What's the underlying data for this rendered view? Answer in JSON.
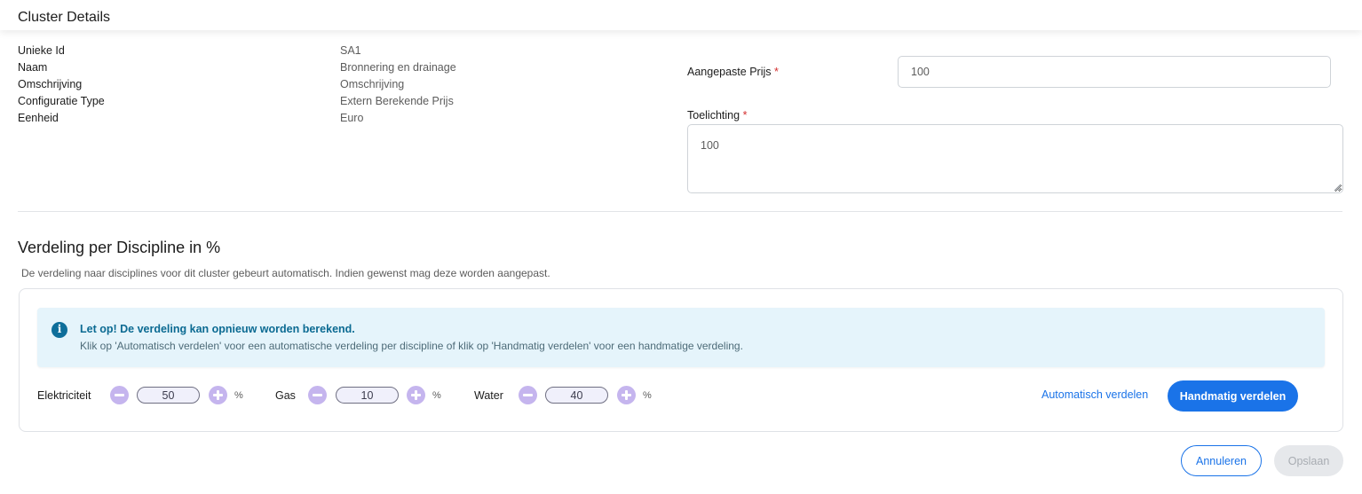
{
  "header": {
    "title": "Cluster Details"
  },
  "details": [
    {
      "label": "Unieke Id",
      "value": "SA1"
    },
    {
      "label": "Naam",
      "value": "Bronnering en drainage"
    },
    {
      "label": "Omschrijving",
      "value": "Omschrijving"
    },
    {
      "label": "Configuratie Type",
      "value": "Extern Berekende Prijs"
    },
    {
      "label": "Eenheid",
      "value": "Euro"
    }
  ],
  "form": {
    "price_label": "Aangepaste Prijs",
    "price_value": "100",
    "notes_label": "Toelichting",
    "notes_value": "100",
    "required_mark": "*"
  },
  "distribution": {
    "title": "Verdeling per Discipline in %",
    "description": "De verdeling naar disciplines voor dit cluster gebeurt automatisch. Indien gewenst mag deze worden aangepast.",
    "alert": {
      "icon": "info-icon",
      "title": "Let op! De verdeling kan opnieuw worden berekend.",
      "text": "Klik op 'Automatisch verdelen' voor een automatische verdeling per discipline of klik op 'Handmatig verdelen' voor een handmatige verdeling."
    },
    "disciplines": [
      {
        "label": "Elektriciteit",
        "value": "50",
        "unit": "%"
      },
      {
        "label": "Gas",
        "value": "10",
        "unit": "%"
      },
      {
        "label": "Water",
        "value": "40",
        "unit": "%"
      }
    ],
    "auto_label": "Automatisch verdelen",
    "manual_label": "Handmatig verdelen"
  },
  "footer": {
    "cancel_label": "Annuleren",
    "save_label": "Opslaan"
  },
  "colors": {
    "primary": "#1a73e8",
    "alert_bg": "#e5f4fb",
    "stepper": "#c5b5ee",
    "required": "#d32f2f"
  }
}
